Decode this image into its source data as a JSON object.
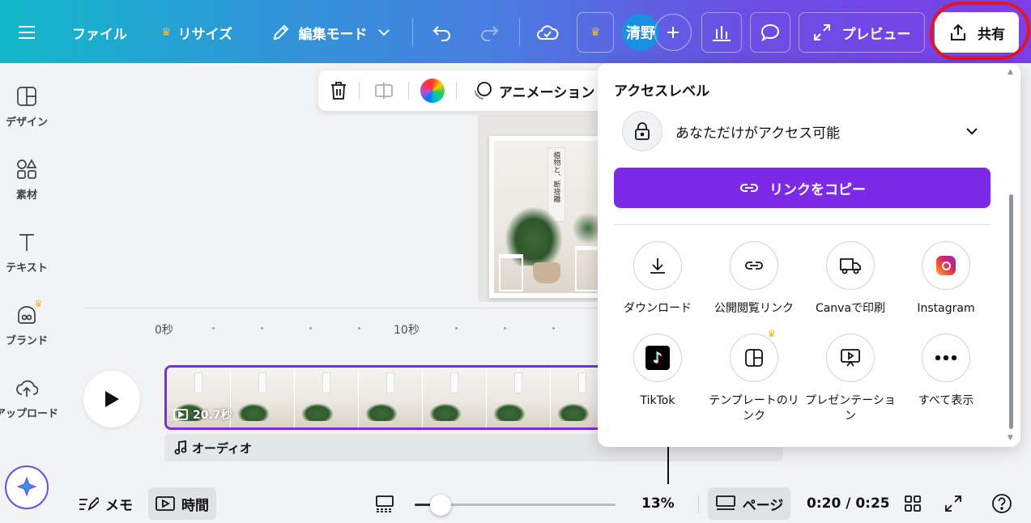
{
  "topbar": {
    "file": "ファイル",
    "resize": "リサイズ",
    "edit_mode": "編集モード",
    "avatar": "清野",
    "preview": "プレビュー",
    "share": "共有"
  },
  "sidebar": {
    "items": [
      {
        "label": "デザイン",
        "icon": "design-icon"
      },
      {
        "label": "素材",
        "icon": "elements-icon"
      },
      {
        "label": "テキスト",
        "icon": "text-icon"
      },
      {
        "label": "ブランド",
        "icon": "brand-icon"
      },
      {
        "label": "アップロード",
        "icon": "upload-icon"
      }
    ]
  },
  "floating_toolbar": {
    "animation": "アニメーション"
  },
  "design": {
    "poster_text": "植物と、断捨離"
  },
  "timeline": {
    "ticks": [
      "0秒",
      "10秒"
    ],
    "clip_duration": "20.7秒",
    "audio_label": "オーディオ"
  },
  "bottombar": {
    "notes": "メモ",
    "timer": "時間",
    "zoom": "13%",
    "zoom_level": 0.13,
    "pages": "ページ",
    "time": "0:20 / 0:25"
  },
  "share_panel": {
    "title": "アクセスレベル",
    "access_value": "あなただけがアクセス可能",
    "copy_link": "リンクをコピー",
    "options": [
      {
        "label": "ダウンロード",
        "icon": "download-icon"
      },
      {
        "label": "公開閲覧リンク",
        "icon": "link-icon"
      },
      {
        "label": "Canvaで印刷",
        "icon": "truck-icon"
      },
      {
        "label": "Instagram",
        "icon": "instagram-icon"
      },
      {
        "label": "TikTok",
        "icon": "tiktok-icon"
      },
      {
        "label": "テンプレートのリンク",
        "icon": "template-icon"
      },
      {
        "label": "プレゼンテーション",
        "icon": "presentation-icon"
      },
      {
        "label": "すべて表示",
        "icon": "more-icon"
      }
    ]
  },
  "colors": {
    "accent": "#7d2ae8",
    "premium": "#f6b73c",
    "annotation": "#e2161b"
  }
}
